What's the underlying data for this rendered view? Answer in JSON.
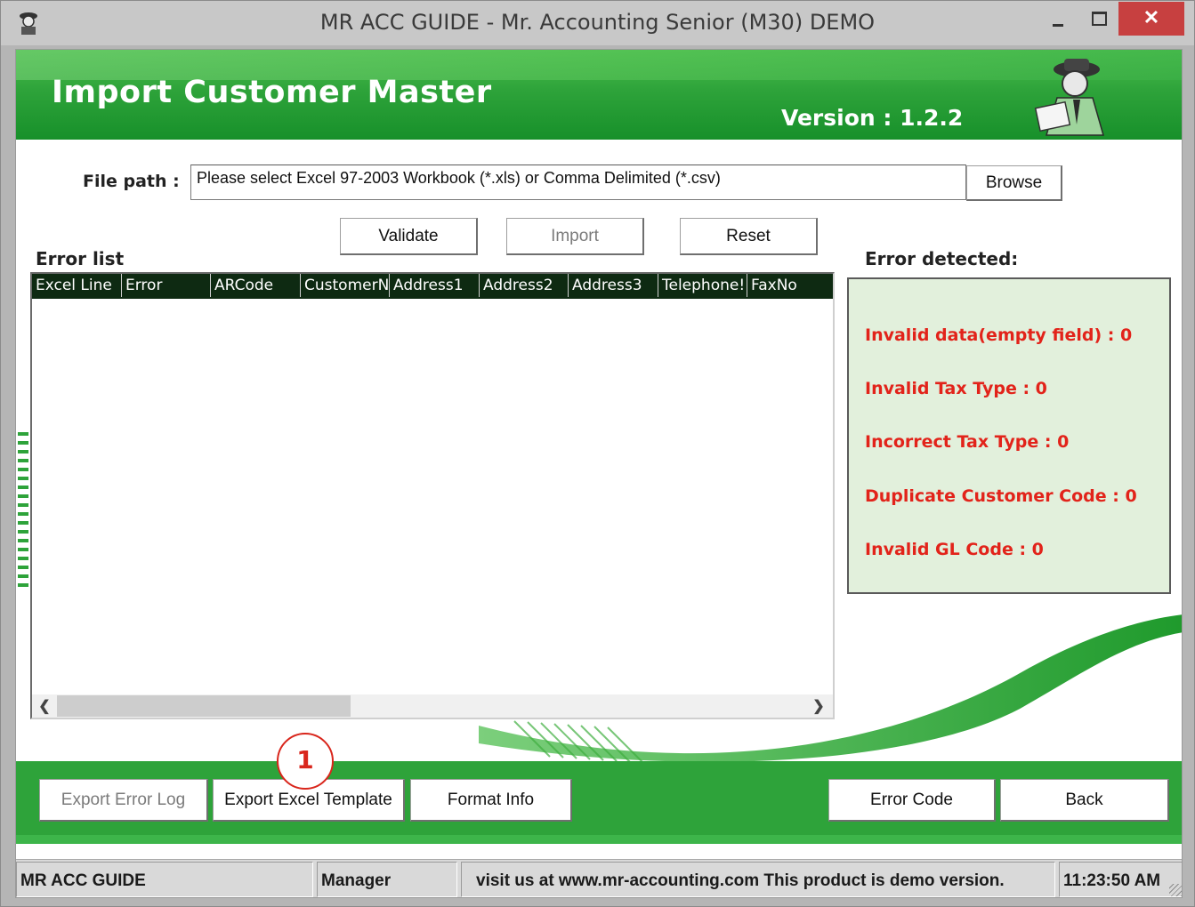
{
  "window": {
    "title": "MR ACC GUIDE - Mr. Accounting Senior (M30) DEMO",
    "close_glyph": "✕"
  },
  "header": {
    "title": "Import Customer Master",
    "version": "Version : 1.2.2"
  },
  "file": {
    "label": "File path :",
    "value": "Please select Excel 97-2003 Workbook (*.xls) or Comma Delimited (*.csv)",
    "browse_label": "Browse"
  },
  "actions": {
    "validate": "Validate",
    "import": "Import",
    "reset": "Reset"
  },
  "error_list": {
    "label": "Error list",
    "columns": [
      "Excel Line",
      "Error",
      "ARCode",
      "CustomerN",
      "Address1",
      "Address2",
      "Address3",
      "Telephone!",
      "FaxNo"
    ]
  },
  "error_detected": {
    "label": "Error detected:",
    "items": [
      "Invalid data(empty field) : 0",
      "Invalid Tax Type : 0",
      "Incorrect Tax Type : 0",
      "Duplicate Customer Code : 0",
      "Invalid GL Code : 0"
    ]
  },
  "footer": {
    "export_error_log": "Export Error Log",
    "export_excel_template": "Export Excel Template",
    "format_info": "Format Info",
    "error_code": "Error Code",
    "back": "Back"
  },
  "callout": {
    "number": "1"
  },
  "statusbar": {
    "app": "MR ACC GUIDE",
    "user": "Manager",
    "message": "visit us at www.mr-accounting.com This product is demo version.",
    "time": "11:23:50 AM"
  },
  "colors": {
    "brand_green": "#2ea33a",
    "error_red": "#e2231a",
    "panel_bg": "#e2f0dc",
    "grid_header": "#0e2a12"
  }
}
